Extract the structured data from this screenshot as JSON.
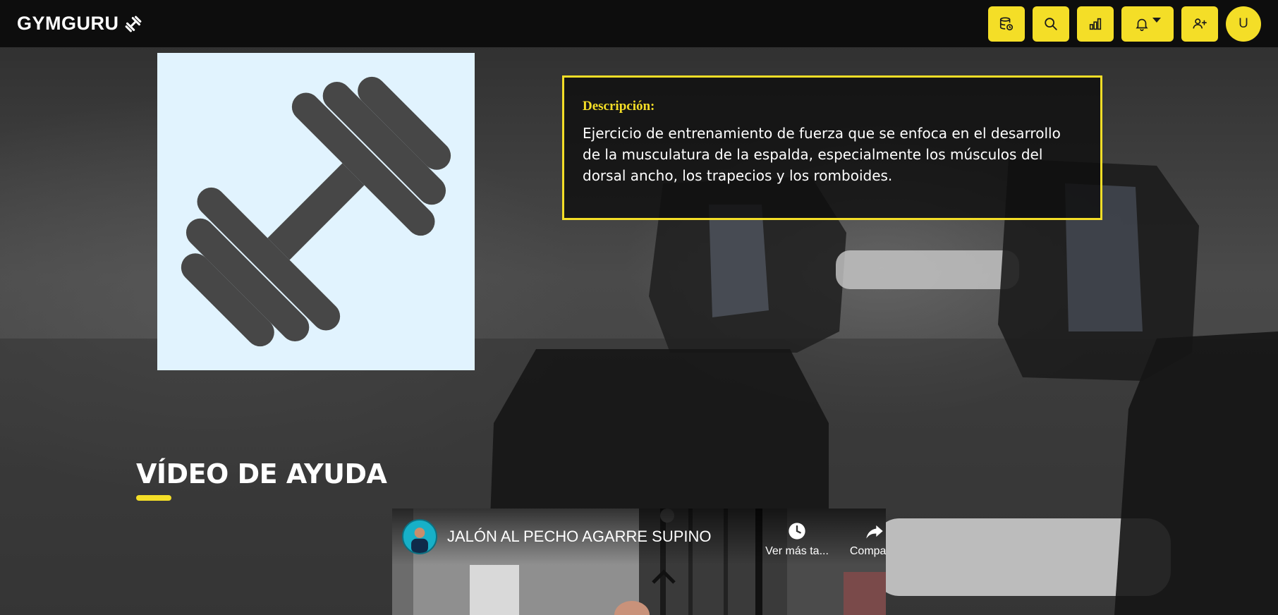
{
  "navbar": {
    "brand": "GYMGURU",
    "brand_icon": "dumbbell-icon",
    "buttons": [
      {
        "name": "database-button",
        "icon": "database-icon"
      },
      {
        "name": "search-button",
        "icon": "search-icon"
      },
      {
        "name": "stats-button",
        "icon": "bar-chart-icon"
      },
      {
        "name": "notifications-button",
        "icon": "bell-icon"
      },
      {
        "name": "add-user-button",
        "icon": "user-plus-icon"
      }
    ],
    "avatar_initial": "U",
    "accent_color": "#f4de27"
  },
  "exercise": {
    "image_icon": "dumbbell-icon",
    "image_bg": "#e1f3fe",
    "description_label": "Descripción:",
    "description": "Ejercicio de entrenamiento de fuerza que se enfoca en el desarrollo de la musculatura de la espalda, especialmente los músculos del dorsal ancho, los trapecios y los romboides."
  },
  "video_section": {
    "title": "VÍDEO DE AYUDA",
    "video": {
      "title": "JALÓN AL PECHO AGARRE SUPINO",
      "watch_later": "Ver más ta...",
      "share": "Compartir",
      "watch_later_icon": "clock-icon",
      "share_icon": "share-icon"
    }
  }
}
